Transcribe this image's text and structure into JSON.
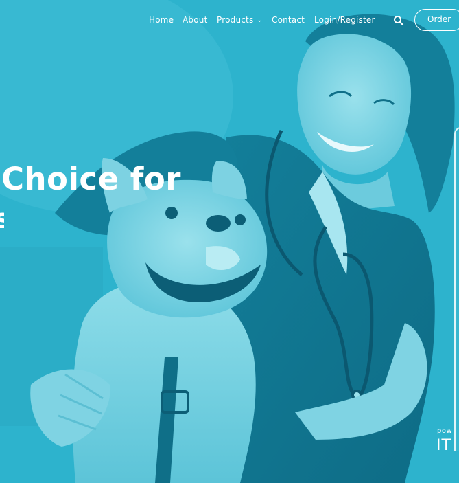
{
  "nav": {
    "items": [
      {
        "label": "Home"
      },
      {
        "label": "About"
      },
      {
        "label": "Products"
      },
      {
        "label": "Contact"
      },
      {
        "label": "Login/Register"
      }
    ],
    "products_chevron": "⌄",
    "search_icon": "search-icon",
    "order_label": "Order"
  },
  "hero": {
    "headline_line1": "Choice for",
    "headline_line2": "s"
  },
  "widget": {
    "powered_label": "pow",
    "brand_label": "IT"
  },
  "colors": {
    "overlay": "#27b2cc",
    "text": "#ffffff"
  }
}
